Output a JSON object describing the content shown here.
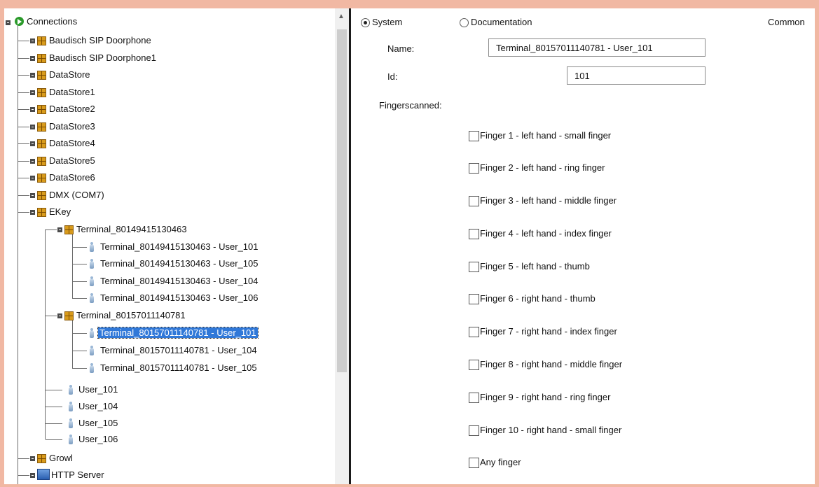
{
  "tree": {
    "root": "Connections",
    "items": [
      "Baudisch SIP Doorphone",
      "Baudisch SIP Doorphone1",
      "DataStore",
      "DataStore1",
      "DataStore2",
      "DataStore3",
      "DataStore4",
      "DataStore5",
      "DataStore6",
      "DMX (COM7)",
      "EKey"
    ],
    "ekey": {
      "terminal_a": "Terminal_80149415130463",
      "terminal_a_users": [
        "Terminal_80149415130463 - User_101",
        "Terminal_80149415130463 - User_105",
        "Terminal_80149415130463 - User_104",
        "Terminal_80149415130463 - User_106"
      ],
      "terminal_b": "Terminal_80157011140781",
      "terminal_b_users": [
        "Terminal_80157011140781 - User_101",
        "Terminal_80157011140781 - User_104",
        "Terminal_80157011140781 - User_105"
      ],
      "users": [
        "User_101",
        "User_104",
        "User_105",
        "User_106"
      ]
    },
    "after": [
      "Growl",
      "HTTP Server"
    ]
  },
  "panel": {
    "radio_system": "System",
    "radio_documentation": "Documentation",
    "common_label": "Common",
    "name_label": "Name:",
    "name_value": "Terminal_80157011140781 - User_101",
    "id_label": "Id:",
    "id_value": "101",
    "fingers_label": "Fingerscanned:",
    "fingers": [
      "Finger 1 - left hand - small finger",
      "Finger 2 - left hand - ring finger",
      "Finger 3 - left hand - middle finger",
      "Finger 4 - left hand - index finger",
      "Finger 5 - left hand - thumb",
      "Finger 6 - right hand - thumb",
      "Finger 7 - right hand - index finger",
      "Finger 8 - right hand - middle finger",
      "Finger 9 - right hand - ring finger",
      "Finger 10 - right hand - small finger",
      "Any finger"
    ]
  },
  "colors": {
    "border": "#f1b8a3",
    "selection": "#3078d8"
  }
}
